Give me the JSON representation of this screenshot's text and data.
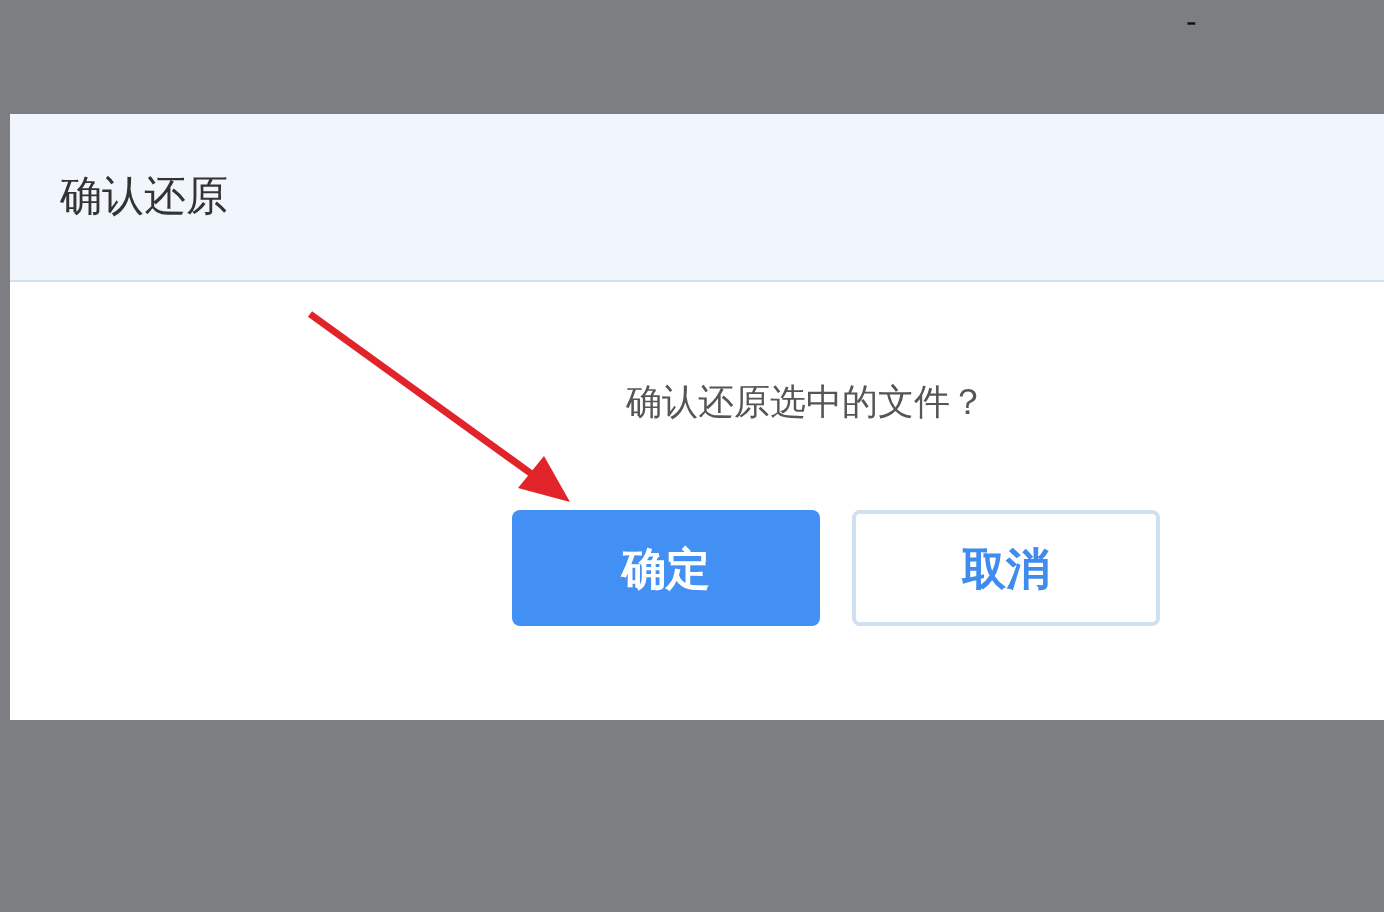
{
  "top_bar": {
    "mark": "-"
  },
  "dialog": {
    "title": "确认还原",
    "message": "确认还原选中的文件？",
    "buttons": [
      {
        "label": "确定",
        "kind": "primary"
      },
      {
        "label": "取消",
        "kind": "secondary"
      }
    ]
  }
}
